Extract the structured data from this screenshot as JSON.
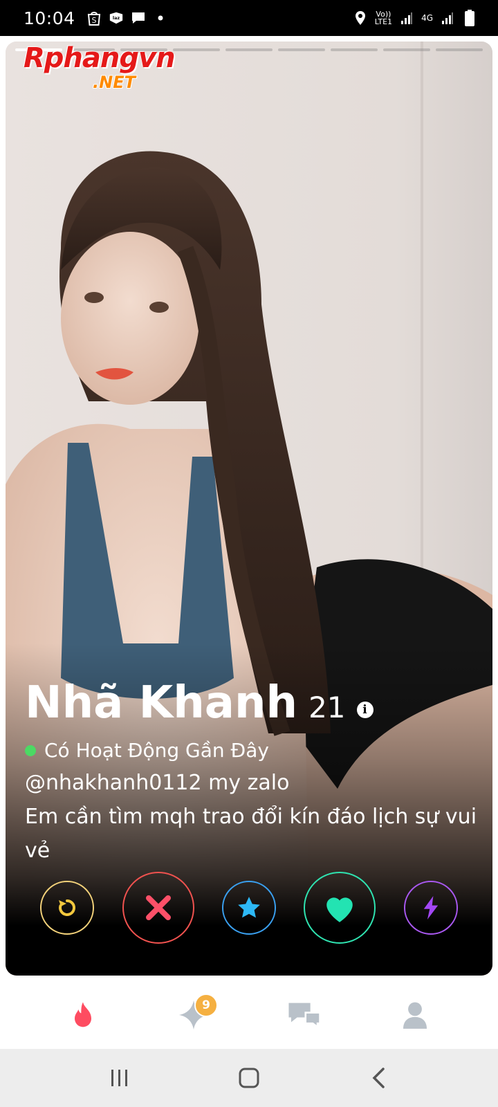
{
  "status_bar": {
    "time": "10:04",
    "net_volte": "Vo))",
    "net_lte": "LTE1",
    "net_4g": "4G",
    "icons": [
      "shopee-icon",
      "lazada-icon",
      "message-icon",
      "dot-icon",
      "location-icon",
      "signal-icon",
      "signal-icon",
      "battery-icon"
    ]
  },
  "watermark": {
    "main": "Rphangvn",
    "suffix": ".NET"
  },
  "profile": {
    "name": "Nhã Khanh",
    "age": "21",
    "info_glyph": "i",
    "activity": "Có Hoạt Động Gần Đây",
    "bio_line1": "@nhakhanh0112 my zalo",
    "bio_line2": "Em cần tìm mqh trao đổi kín đáo lịch sự vui vẻ",
    "photo_count": 9,
    "photo_index": 1
  },
  "actions": [
    {
      "name": "rewind",
      "color": "#f3d27a"
    },
    {
      "name": "nope",
      "color": "#f0524f"
    },
    {
      "name": "super-like",
      "color": "#3aa0f0"
    },
    {
      "name": "like",
      "color": "#2fe3b0"
    },
    {
      "name": "boost",
      "color": "#a958f0"
    }
  ],
  "bottom_nav": {
    "active_color": "#fe4c61",
    "inactive_color": "#b9c1c9",
    "badge": "9"
  }
}
